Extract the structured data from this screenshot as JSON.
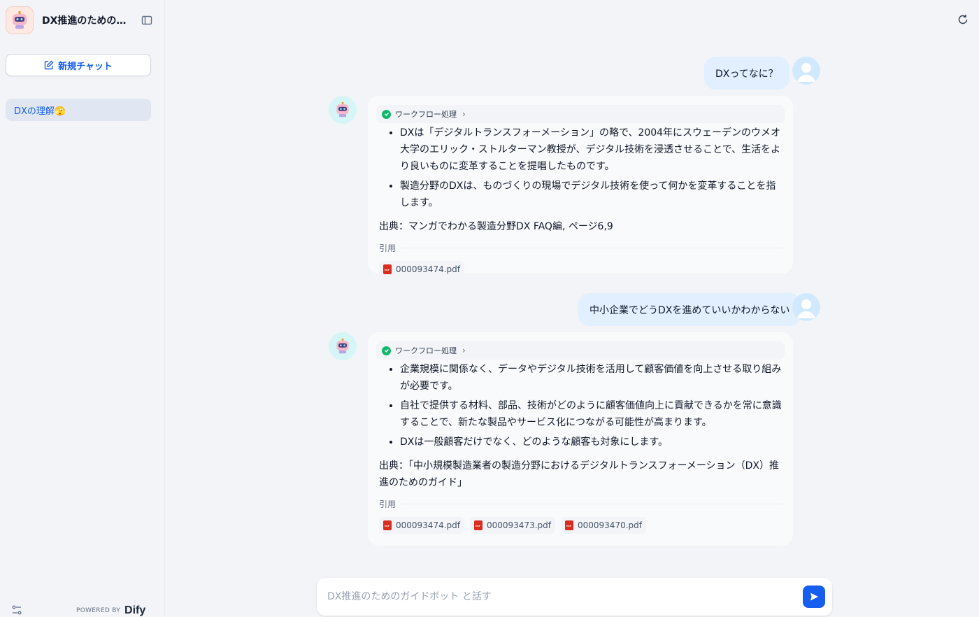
{
  "sidebar": {
    "app_title": "DX推進のためのガ...",
    "new_chat_label": "新規チャット",
    "conversations": [
      {
        "label": "DXの理解🫣"
      }
    ],
    "powered_by": "POWERED BY",
    "brand": "Dify"
  },
  "messages": [
    {
      "role": "user",
      "text": "DXってなに？"
    },
    {
      "role": "assistant",
      "workflow_label": "ワークフロー処理",
      "bullets": [
        "DXは「デジタルトランスフォーメーション」の略で、2004年にスウェーデンのウメオ大学のエリック・ストルターマン教授が、デジタル技術を浸透させることで、生活をより良いものに変革することを提唱したものです。",
        "製造分野のDXは、ものづくりの現場でデジタル技術を使って何かを変革することを指します。"
      ],
      "source": "出典：マンガでわかる製造分野DX FAQ編, ページ6,9",
      "citation_label": "引用",
      "files": [
        "000093474.pdf"
      ]
    },
    {
      "role": "user",
      "text": "中小企業でどうDXを進めていいかわからない"
    },
    {
      "role": "assistant",
      "workflow_label": "ワークフロー処理",
      "bullets": [
        "企業規模に関係なく、データやデジタル技術を活用して顧客価値を向上させる取り組みが必要です。",
        "自社で提供する材料、部品、技術がどのように顧客価値向上に貢献できるかを常に意識することで、新たな製品やサービス化につながる可能性が高まります。",
        "DXは一般顧客だけでなく、どのような顧客も対象にします。"
      ],
      "source": "出典：「中小規模製造業者の製造分野におけるデジタルトランスフォーメーション（DX）推進のためのガイド」",
      "citation_label": "引用",
      "files": [
        "000093474.pdf",
        "000093473.pdf",
        "000093470.pdf"
      ]
    }
  ],
  "input": {
    "placeholder": "DX推進のためのガイドボット と話す"
  },
  "colors": {
    "accent": "#155eef",
    "user_bubble": "#e1effe",
    "bot_card": "#f9fafb",
    "background": "#f2f4f7"
  }
}
